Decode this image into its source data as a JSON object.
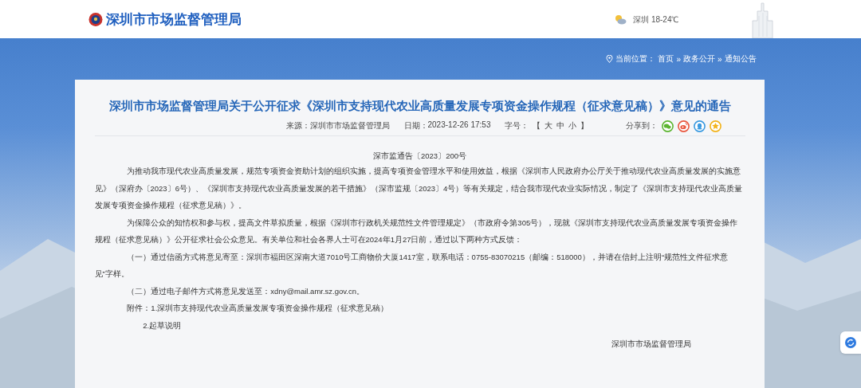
{
  "header": {
    "site_name": "深圳市市场监督管理局",
    "weather": "深圳 18-24℃"
  },
  "breadcrumb": {
    "label": "当前位置：",
    "separator": "»",
    "items": [
      "首页",
      "政务公开",
      "通知公告"
    ]
  },
  "article": {
    "title": "深圳市市场监督管理局关于公开征求《深圳市支持现代农业高质量发展专项资金操作规程（征求意见稿）》意见的通告",
    "meta": [
      {
        "label": "来源：",
        "value": "深圳市市场监督管理局"
      },
      {
        "label": "日期：",
        "value": "2023-12-26 17:53"
      }
    ],
    "font_size": {
      "label": "字号：",
      "open": "【",
      "close": "】",
      "options": [
        "大",
        "中",
        "小"
      ]
    },
    "share": {
      "label": "分享到：",
      "targets": [
        {
          "kind": "wechat",
          "color": "#5cb531"
        },
        {
          "kind": "weibo",
          "color": "#e9573f"
        },
        {
          "kind": "qq",
          "color": "#3a9ae0"
        },
        {
          "kind": "favorite",
          "color": "#f2b31b"
        }
      ]
    },
    "doc_number": "深市监通告〔2023〕200号",
    "paragraphs": [
      {
        "kind": "indent",
        "text": "为推动我市现代农业高质量发展，规范专项资金资助计划的组织实施，提高专项资金管理水平和使用效益，根据《深圳市人民政府办公厅关于推动现代农业高质量发展的实施意见》（深府办〔2023〕6号）、《深圳市支持现代农业高质量发展的若干措施》（深市监规〔2023〕4号）等有关规定，结合我市现代农业实际情况，制定了《深圳市支持现代农业高质量发展专项资金操作规程（征求意见稿）》。"
      },
      {
        "kind": "indent",
        "text": "为保障公众的知情权和参与权，提高文件草拟质量，根据《深圳市行政机关规范性文件管理规定》（市政府令第305号），现就《深圳市支持现代农业高质量发展专项资金操作规程（征求意见稿）》公开征求社会公众意见。有关单位和社会各界人士可在2024年1月27日前，通过以下两种方式反馈："
      },
      {
        "kind": "indent",
        "text": "（一）通过信函方式将意见寄至：深圳市福田区深南大道7010号工商物价大厦1417室，联系电话：0755-83070215（邮编：518000），并请在信封上注明“规范性文件征求意见”字样。"
      },
      {
        "kind": "indent",
        "text": "（二）通过电子邮件方式将意见发送至：xdny@mail.amr.sz.gov.cn。"
      },
      {
        "kind": "indent",
        "text": "附件：1.深圳市支持现代农业高质量发展专项资金操作规程（征求意见稿）"
      },
      {
        "kind": "sub",
        "text": "2.起草说明"
      }
    ],
    "signature": "深圳市市场监督管理局"
  }
}
